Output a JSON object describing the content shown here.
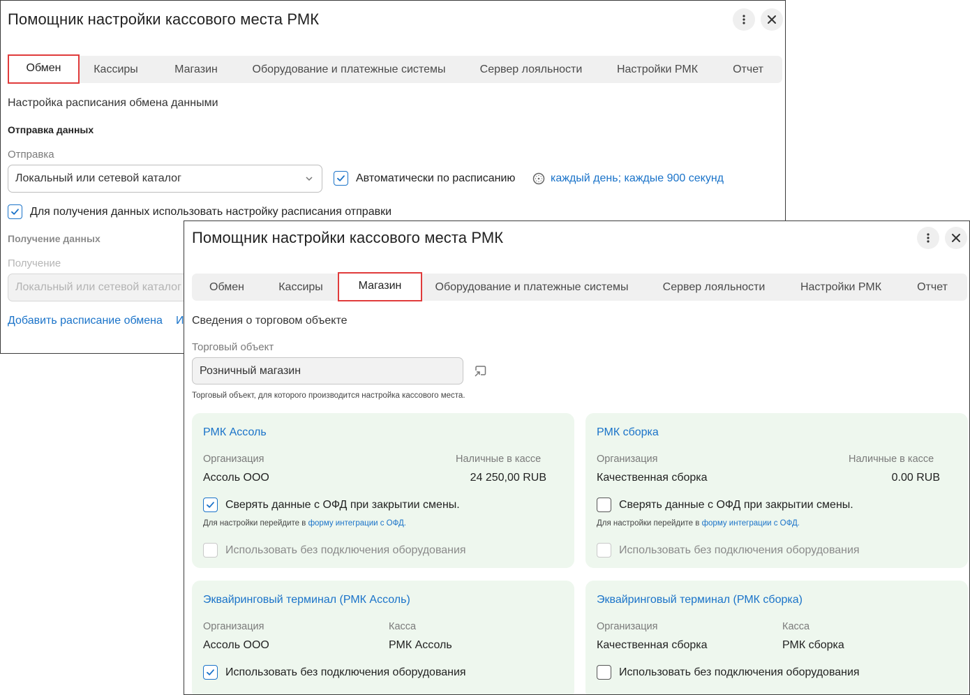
{
  "icons": {
    "more": "more-vertical-icon",
    "close": "close-icon",
    "chevron": "chevron-down-icon",
    "schedule": "clock-icon",
    "check": "check-icon",
    "open": "open-link-icon"
  },
  "colors": {
    "accent": "#1a73c9",
    "active_tab_border": "#e03b3b",
    "card_bg": "#eef7ee"
  },
  "window1": {
    "title": "Помощник настройки кассового места РМК",
    "tabs": [
      {
        "label": "Обмен",
        "active": true
      },
      {
        "label": "Кассиры"
      },
      {
        "label": "Магазин"
      },
      {
        "label": "Оборудование и платежные системы"
      },
      {
        "label": "Сервер лояльности"
      },
      {
        "label": "Настройки РМК"
      },
      {
        "label": "Отчет"
      }
    ],
    "section_title": "Настройка расписания обмена данными",
    "send_group": "Отправка данных",
    "send_label": "Отправка",
    "send_value": "Локальный или сетевой каталог",
    "auto_schedule_label": "Автоматически по расписанию",
    "schedule_link": "каждый день; каждые 900 секунд",
    "use_send_schedule_label": "Для получения данных использовать настройку расписания отправки",
    "receive_group": "Получение данных",
    "receive_label": "Получение",
    "receive_value": "Локальный или сетевой каталог",
    "add_schedule_link": "Добавить расписание обмена",
    "other_link": "И"
  },
  "window2": {
    "title": "Помощник настройки кассового места РМК",
    "tabs": [
      {
        "label": "Обмен"
      },
      {
        "label": "Кассиры"
      },
      {
        "label": "Магазин",
        "active": true
      },
      {
        "label": "Оборудование и платежные системы"
      },
      {
        "label": "Сервер лояльности"
      },
      {
        "label": "Настройки РМК"
      },
      {
        "label": "Отчет"
      }
    ],
    "section_title": "Сведения о торговом объекте",
    "store_label": "Торговый объект",
    "store_value": "Розничный магазин",
    "store_hint": "Торговый объект, для которого производится настройка кассового места.",
    "cards": [
      {
        "name": "РМК Ассоль",
        "org_label": "Организация",
        "org_value": "Ассоль ООО",
        "cash_label": "Наличные в кассе",
        "cash_value": "24 250,00 RUB",
        "ofd_label": "Сверять данные с ОФД при закрытии смены.",
        "ofd_checked": true,
        "hint_prefix": "Для настройки перейдите в",
        "hint_link": "форму интеграции с ОФД.",
        "no_equipment_label": "Использовать без подключения оборудования"
      },
      {
        "name": "РМК сборка",
        "org_label": "Организация",
        "org_value": "Качественная сборка",
        "cash_label": "Наличные в кассе",
        "cash_value": "0.00 RUB",
        "ofd_label": "Сверять данные с ОФД при закрытии смены.",
        "ofd_checked": false,
        "hint_prefix": "Для настройки перейдите в",
        "hint_link": "форму интеграции с ОФД.",
        "no_equipment_label": "Использовать без подключения оборудования"
      }
    ],
    "terminals": [
      {
        "name": "Эквайринговый терминал  (РМК Ассоль)",
        "org_label": "Организация",
        "org_value": "Ассоль ООО",
        "kassa_label": "Касса",
        "kassa_value": "РМК Ассоль",
        "no_equipment_label": "Использовать без подключения оборудования",
        "no_equipment_checked": true
      },
      {
        "name": "Эквайринговый терминал  (РМК сборка)",
        "org_label": "Организация",
        "org_value": "Качественная сборка",
        "kassa_label": "Касса",
        "kassa_value": "РМК сборка",
        "no_equipment_label": "Использовать без подключения оборудования",
        "no_equipment_checked": false
      }
    ]
  }
}
